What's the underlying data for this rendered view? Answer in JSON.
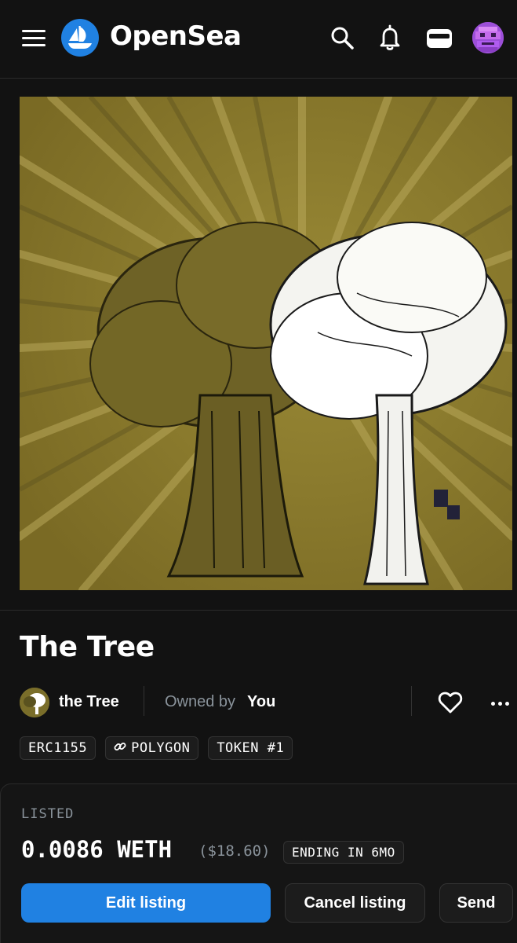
{
  "header": {
    "brand": "OpenSea",
    "icons": [
      "menu-icon",
      "opensea-logo-icon",
      "search-icon",
      "bell-icon",
      "wallet-icon",
      "avatar"
    ]
  },
  "item": {
    "title": "The Tree",
    "collection_name": "the Tree",
    "owned_by_label": "Owned by",
    "owner_name": "You",
    "tags": [
      "ERC1155",
      "POLYGON",
      "TOKEN #1"
    ]
  },
  "listing": {
    "status_label": "LISTED",
    "price": "0.0086 WETH",
    "usd_price": "($18.60)",
    "ending": "ENDING IN 6MO",
    "edit_label": "Edit listing",
    "cancel_label": "Cancel listing",
    "send_label": "Send"
  },
  "colors": {
    "background": "#121212",
    "accent": "#2081e2",
    "muted_text": "#8a939b",
    "art_gold": "#8a7a2a"
  }
}
